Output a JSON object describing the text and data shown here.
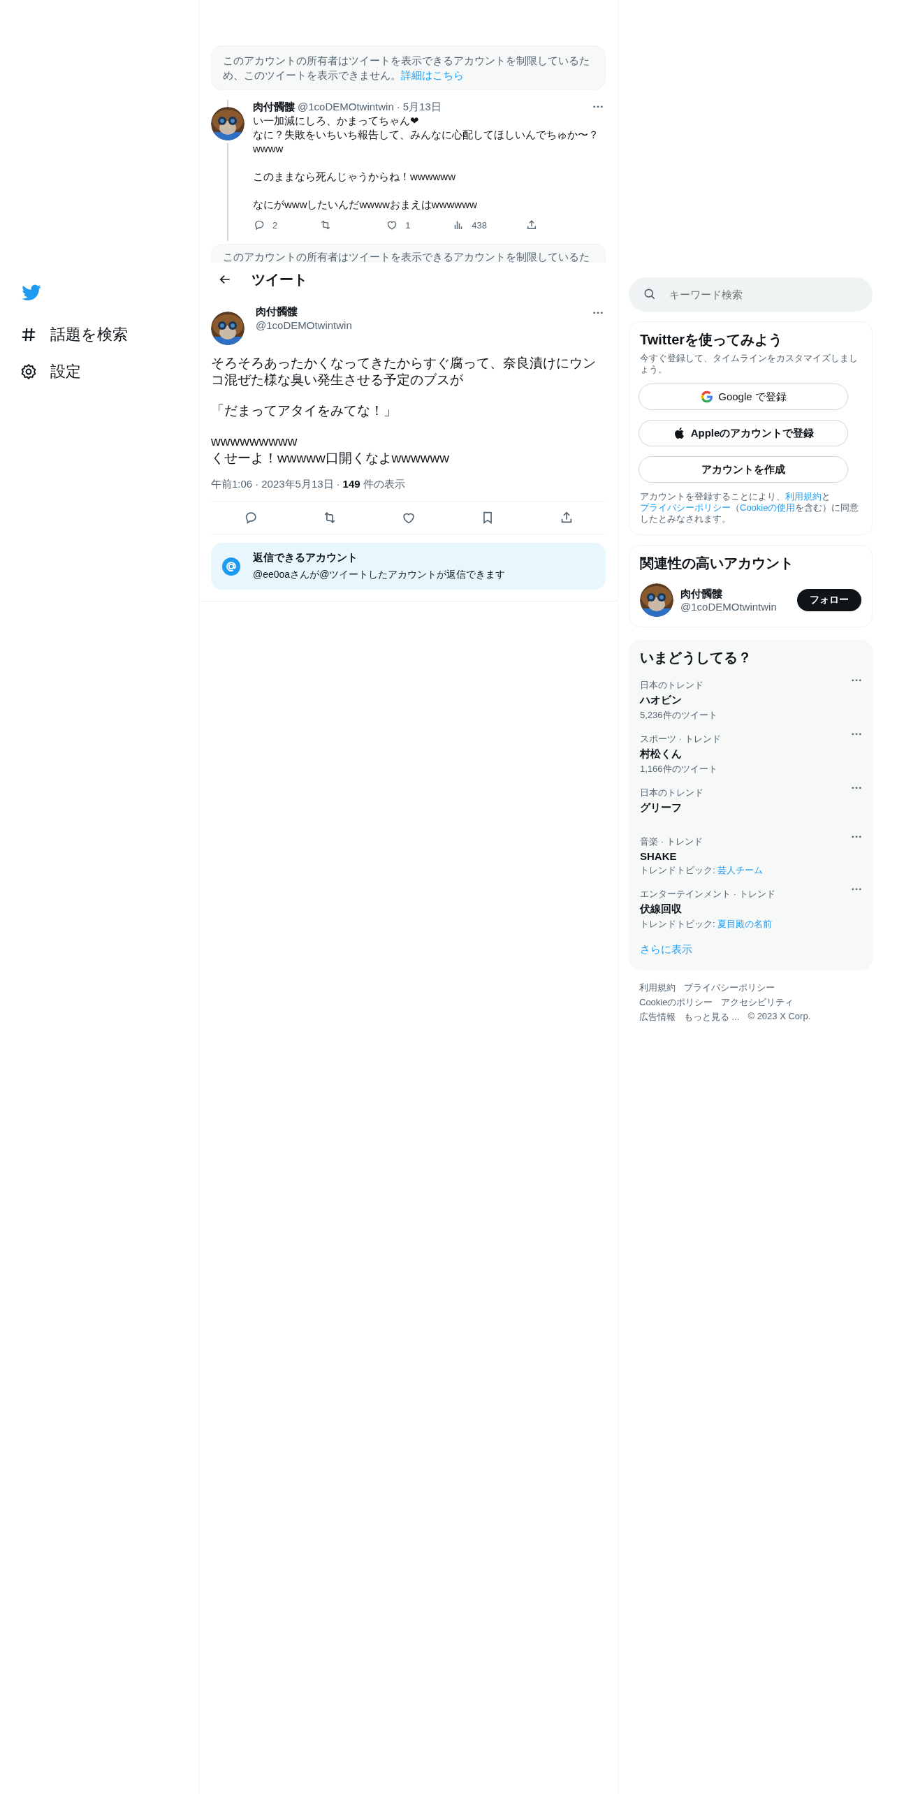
{
  "sidebar": {
    "items": [
      {
        "kind": "explore",
        "label": "話題を検索"
      },
      {
        "kind": "settings",
        "label": "設定"
      }
    ]
  },
  "timeline": {
    "notice": {
      "text": "このアカウントの所有者はツイートを表示できるアカウントを制限しているため、このツイートを表示できません。",
      "link": "詳細はこちら"
    },
    "thread_tweet": {
      "name": "肉付髑髏",
      "handle": "@1coDEMOtwintwin",
      "separator": "·",
      "date": "5月13日",
      "paragraphs": [
        [
          "い一加減にしろ、かまってちゃん❤",
          "なに？失敗をいちいち報告して、みんなに心配してほしいんでちゅか〜？wwww"
        ],
        [
          "このままなら死んじゃうからね！wwwwww"
        ],
        [
          "なにがwwwしたいんだwwwwおまえはwwwwww"
        ]
      ],
      "actions": [
        {
          "kind": "reply",
          "count": "2"
        },
        {
          "kind": "retweet"
        },
        {
          "kind": "like",
          "count": "1"
        },
        {
          "kind": "views",
          "count": "438"
        },
        {
          "kind": "share"
        }
      ]
    },
    "partial_notice": "このアカウントの所有者はツイートを表示できるアカウントを制限しているた"
  },
  "header": {
    "title": "ツイート"
  },
  "tweet": {
    "name": "肉付髑髏",
    "handle": "@1coDEMOtwintwin",
    "paragraphs": [
      [
        "そろそろあったかくなってきたからすぐ腐って、奈良漬けにウンコ混ぜた様な臭い発生させる予定のブスが"
      ],
      [
        "「だまってアタイをみてな！」"
      ],
      [
        "wwwwwwwww",
        "くせーよ！wwwww口開くなよwwwwww"
      ]
    ],
    "time": "午前1:06",
    "separator": "·",
    "date": "2023年5月13日",
    "views": "149",
    "views_label": "件の表示",
    "actions": [
      {
        "kind": "reply"
      },
      {
        "kind": "retweet"
      },
      {
        "kind": "like"
      },
      {
        "kind": "bookmark"
      },
      {
        "kind": "share"
      }
    ]
  },
  "reply_restriction": {
    "title": "返信できるアカウント",
    "text": "@ee0oaさんが@ツイートしたアカウントが返信できます"
  },
  "search": {
    "placeholder": "キーワード検索"
  },
  "signup": {
    "title": "Twitterを使ってみよう",
    "subtitle": "今すぐ登録して、タイムラインをカスタマイズしましょう。",
    "buttons": [
      {
        "kind": "google",
        "label": "Google で登録"
      },
      {
        "kind": "apple",
        "label": "Appleのアカウントで登録"
      },
      {
        "kind": "create",
        "label": "アカウントを作成"
      }
    ],
    "legal": [
      {
        "text": "アカウントを登録することにより、",
        "link": false
      },
      {
        "text": "利用規約",
        "link": true
      },
      {
        "text": "と",
        "link": false
      },
      {
        "text": "プライバシーポリシー",
        "link": true
      },
      {
        "text": "（",
        "link": false
      },
      {
        "text": "Cookieの使用",
        "link": true
      },
      {
        "text": "を含む）に同意したとみなされます。",
        "link": false
      }
    ]
  },
  "related": {
    "title": "関連性の高いアカウント",
    "account": {
      "name": "肉付髑髏",
      "handle": "@1coDEMOtwintwin",
      "button": "フォロー"
    }
  },
  "trends": {
    "title": "いまどうしてる？",
    "items": [
      {
        "category": "日本のトレンド",
        "name": "ハオビン",
        "count": "5,236件のツイート"
      },
      {
        "category": "スポーツ · トレンド",
        "name": "村松くん",
        "count": "1,166件のツイート"
      },
      {
        "category": "日本のトレンド",
        "name": "グリーフ"
      },
      {
        "category": "音楽 · トレンド",
        "name": "SHAKE",
        "topic_label": "トレンドトピック:",
        "topic": "芸人チーム"
      },
      {
        "category": "エンターテインメント · トレンド",
        "name": "伏線回収",
        "topic_label": "トレンドトピック:",
        "topic": "夏目殿の名前"
      }
    ],
    "more": "さらに表示"
  },
  "footer": {
    "links": [
      "利用規約",
      "プライバシーポリシー",
      "Cookieのポリシー",
      "アクセシビリティ",
      "広告情報",
      "もっと見る ..."
    ],
    "copyright": "© 2023 X Corp."
  }
}
